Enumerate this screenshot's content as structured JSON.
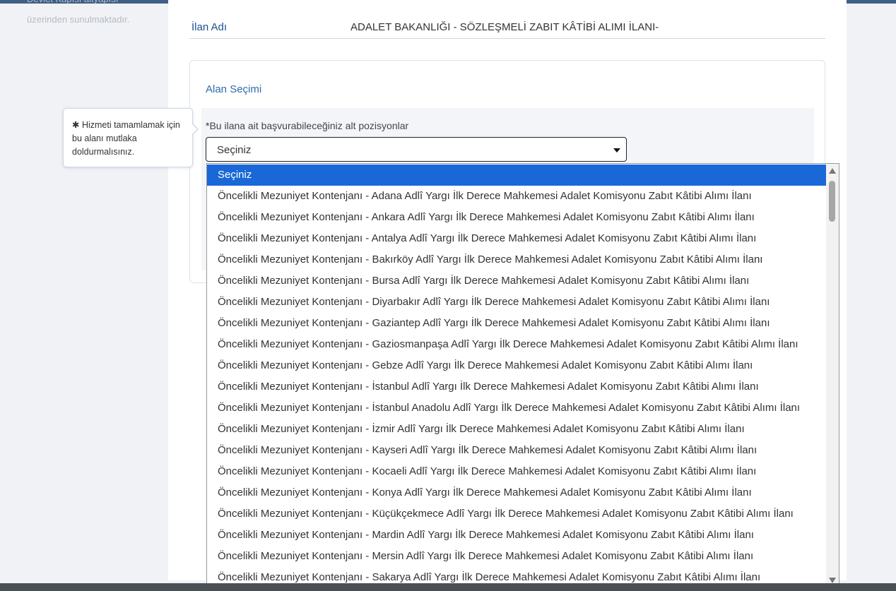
{
  "left_note": {
    "line1": "Devlet Kapısı altyapısı",
    "line2": "üzerinden sunulmaktadır."
  },
  "field": {
    "label": "İlan Adı",
    "value": "ADALET BAKANLIĞI - SÖZLEŞMELİ ZABIT KÂTİBİ ALIMI İLANI-"
  },
  "section": {
    "title": "Alan Seçimi",
    "required_mark": "*",
    "question": "Bu ilana ait başvurabileceğiniz alt pozisyonlar",
    "select_value": "Seçiniz"
  },
  "tooltip": {
    "text": "✱ Hizmeti tamamlamak için bu alanı mutlaka doldurmalısınız."
  },
  "dropdown": {
    "options": [
      "Seçiniz",
      "Öncelikli Mezuniyet Kontenjanı - Adana Adlî Yargı İlk Derece Mahkemesi Adalet Komisyonu Zabıt Kâtibi Alımı İlanı",
      "Öncelikli Mezuniyet Kontenjanı - Ankara Adlî Yargı İlk Derece Mahkemesi Adalet Komisyonu Zabıt Kâtibi Alımı İlanı",
      "Öncelikli Mezuniyet Kontenjanı - Antalya Adlî Yargı İlk Derece Mahkemesi Adalet Komisyonu Zabıt Kâtibi Alımı İlanı",
      "Öncelikli Mezuniyet Kontenjanı - Bakırköy Adlî Yargı İlk Derece Mahkemesi Adalet Komisyonu Zabıt Kâtibi Alımı İlanı",
      "Öncelikli Mezuniyet Kontenjanı - Bursa Adlî Yargı İlk Derece Mahkemesi Adalet Komisyonu Zabıt Kâtibi Alımı İlanı",
      "Öncelikli Mezuniyet Kontenjanı - Diyarbakır Adlî Yargı İlk Derece Mahkemesi Adalet Komisyonu Zabıt Kâtibi Alımı İlanı",
      "Öncelikli Mezuniyet Kontenjanı - Gaziantep Adlî Yargı İlk Derece Mahkemesi Adalet Komisyonu Zabıt Kâtibi Alımı İlanı",
      "Öncelikli Mezuniyet Kontenjanı - Gaziosmanpaşa Adlî Yargı İlk Derece Mahkemesi Adalet Komisyonu Zabıt Kâtibi Alımı İlanı",
      "Öncelikli Mezuniyet Kontenjanı - Gebze Adlî Yargı İlk Derece Mahkemesi Adalet Komisyonu Zabıt Kâtibi Alımı İlanı",
      "Öncelikli Mezuniyet Kontenjanı - İstanbul Adlî Yargı İlk Derece Mahkemesi Adalet Komisyonu Zabıt Kâtibi Alımı İlanı",
      "Öncelikli Mezuniyet Kontenjanı - İstanbul Anadolu Adlî Yargı İlk Derece Mahkemesi Adalet Komisyonu Zabıt Kâtibi Alımı İlanı",
      "Öncelikli Mezuniyet Kontenjanı - İzmir Adlî Yargı İlk Derece Mahkemesi Adalet Komisyonu Zabıt Kâtibi Alımı İlanı",
      "Öncelikli Mezuniyet Kontenjanı - Kayseri Adlî Yargı İlk Derece Mahkemesi Adalet Komisyonu Zabıt Kâtibi Alımı İlanı",
      "Öncelikli Mezuniyet Kontenjanı - Kocaeli Adlî Yargı İlk Derece Mahkemesi Adalet Komisyonu Zabıt Kâtibi Alımı İlanı",
      "Öncelikli Mezuniyet Kontenjanı - Konya Adlî Yargı İlk Derece Mahkemesi Adalet Komisyonu Zabıt Kâtibi Alımı İlanı",
      "Öncelikli Mezuniyet Kontenjanı - Küçükçekmece Adlî Yargı İlk Derece Mahkemesi Adalet Komisyonu Zabıt Kâtibi Alımı İlanı",
      "Öncelikli Mezuniyet Kontenjanı - Mardin Adlî Yargı İlk Derece Mahkemesi Adalet Komisyonu Zabıt Kâtibi Alımı İlanı",
      "Öncelikli Mezuniyet Kontenjanı - Mersin Adlî Yargı İlk Derece Mahkemesi Adalet Komisyonu Zabıt Kâtibi Alımı İlanı",
      "Öncelikli Mezuniyet Kontenjanı - Sakarya Adlî Yargı İlk Derece Mahkemesi Adalet Komisyonu Zabıt Kâtibi Alımı İlanı"
    ],
    "selected_index": 0
  },
  "colors": {
    "accent": "#1a68d7",
    "label_blue": "#1d4f91",
    "topbar": "#3f5f86"
  }
}
